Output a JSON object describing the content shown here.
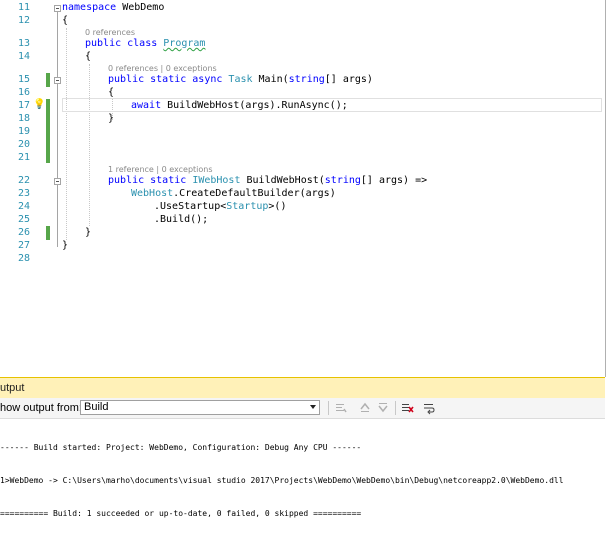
{
  "editor": {
    "line_numbers": [
      "11",
      "12",
      "13",
      "14",
      "15",
      "16",
      "17",
      "18",
      "19",
      "20",
      "21",
      "22",
      "23",
      "24",
      "25",
      "26",
      "27",
      "28"
    ],
    "codelens": {
      "program_refs": "0 references",
      "main_refs": "0 references | 0 exceptions",
      "build_refs": "1 reference | 0 exceptions"
    },
    "code": {
      "l11_kw": "namespace",
      "l11_name": " WebDemo",
      "l12": "{",
      "l13_kw": "public class",
      "l13_name": "Program",
      "l14": "{",
      "l15_kw1": "public static async",
      "l15_type": "Task",
      "l15_mid": " Main(",
      "l15_kw2": "string",
      "l15_end": "[] args)",
      "l16": "{",
      "l17_kw": "await",
      "l17_rest": " BuildWebHost(args).RunAsync();",
      "l18": "}",
      "l22_kw": "public static",
      "l22_type": "IWebHost",
      "l22_mid": " BuildWebHost(",
      "l22_kw2": "string",
      "l22_end": "[] args) =>",
      "l23_type": "WebHost",
      "l23_rest": ".CreateDefaultBuilder(args)",
      "l24_pre": ".UseStartup<",
      "l24_type": "Startup",
      "l24_post": ">()",
      "l25": ".Build();",
      "l26": "}",
      "l27": "}"
    }
  },
  "output": {
    "header_title": "utput",
    "show_label": "how output from:",
    "source_value": "Build",
    "lines": [
      "------ Build started: Project: WebDemo, Configuration: Debug Any CPU ------",
      "1>WebDemo -> C:\\Users\\marho\\documents\\visual studio 2017\\Projects\\WebDemo\\WebDemo\\bin\\Debug\\netcoreapp2.0\\WebDemo.dll",
      "========== Build: 1 succeeded or up-to-date, 0 failed, 0 skipped =========="
    ]
  },
  "colors": {
    "keyword": "#0000ff",
    "type": "#2b91af",
    "line_number": "#2b91af",
    "change_marker": "#57a64a",
    "output_header": "#fff1b8"
  },
  "icons": [
    "lightbulb-icon",
    "find-message-icon",
    "prev-message-icon",
    "next-message-icon",
    "clear-all-icon",
    "word-wrap-icon"
  ]
}
